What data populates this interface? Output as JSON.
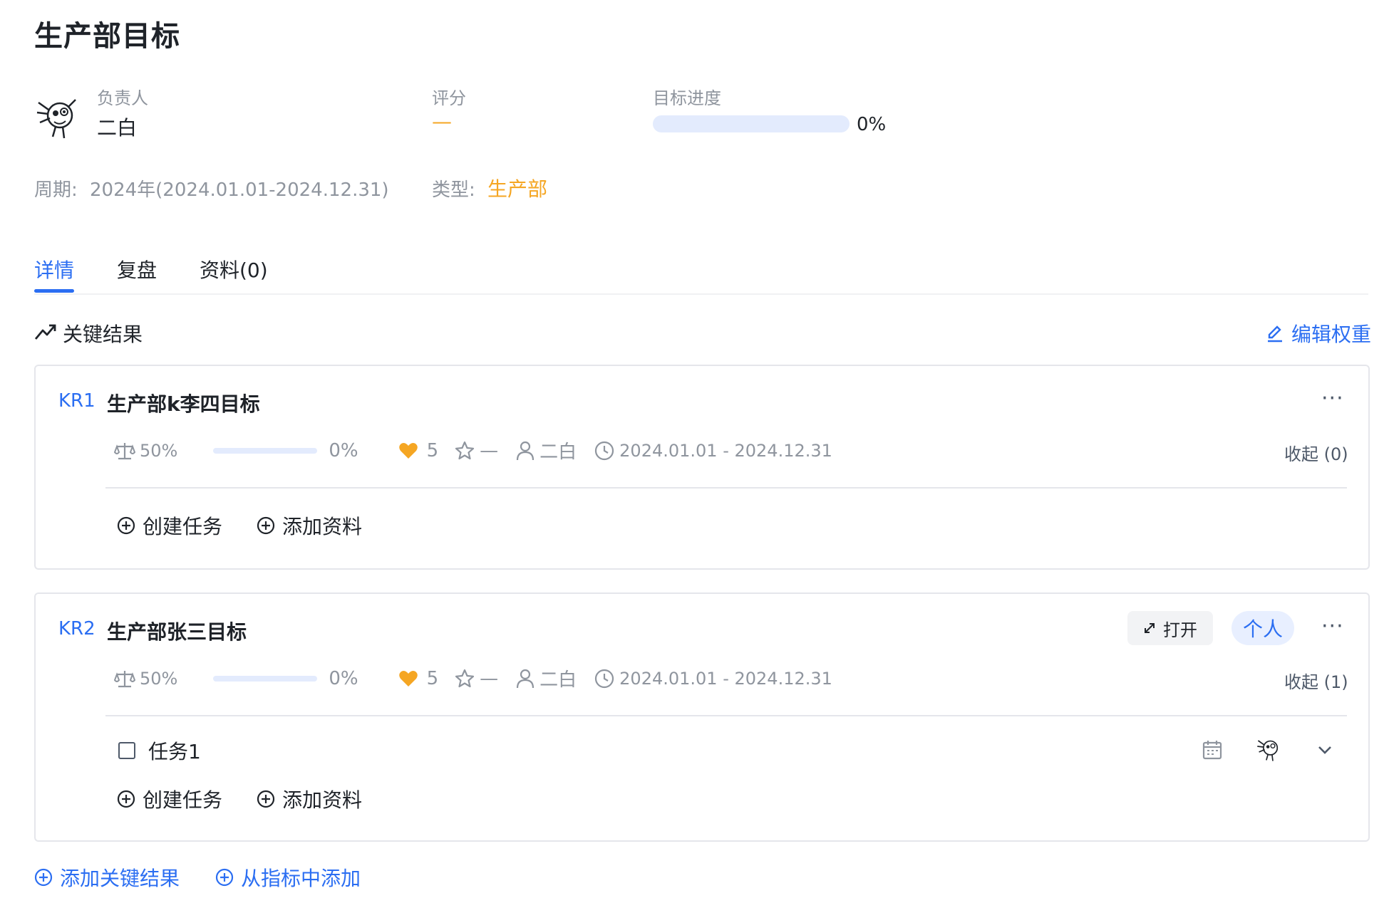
{
  "page": {
    "title": "生产部目标"
  },
  "owner": {
    "label": "负责人",
    "name": "二白"
  },
  "score": {
    "label": "评分",
    "value": "—"
  },
  "progress": {
    "label": "目标进度",
    "value_text": "0%",
    "value": 0
  },
  "period": {
    "label": "周期:",
    "value": "2024年(2024.01.01-2024.12.31)"
  },
  "type": {
    "label": "类型:",
    "value": "生产部"
  },
  "tabs": [
    {
      "label": "详情",
      "active": true
    },
    {
      "label": "复盘",
      "active": false
    },
    {
      "label": "资料(0)",
      "active": false
    }
  ],
  "key_results": {
    "section_title": "关键结果",
    "edit_weight_label": "编辑权重",
    "items": [
      {
        "code": "KR1",
        "title": "生产部k李四目标",
        "weight": "50%",
        "progress_text": "0%",
        "progress": 0,
        "confidence": "5",
        "rating": "—",
        "owner": "二白",
        "date_range": "2024.01.01 - 2024.12.31",
        "collapse_label": "收起 (0)",
        "actions": {
          "create_task": "创建任务",
          "add_material": "添加资料"
        }
      },
      {
        "code": "KR2",
        "title": "生产部张三目标",
        "open_label": "打开",
        "tag": "个人",
        "weight": "50%",
        "progress_text": "0%",
        "progress": 0,
        "confidence": "5",
        "rating": "—",
        "owner": "二白",
        "date_range": "2024.01.01 - 2024.12.31",
        "collapse_label": "收起 (1)",
        "tasks": [
          {
            "name": "任务1",
            "done": false
          }
        ],
        "actions": {
          "create_task": "创建任务",
          "add_material": "添加资料"
        }
      }
    ]
  },
  "footer": {
    "add_kr": "添加关键结果",
    "add_from_metric": "从指标中添加"
  },
  "colors": {
    "accent_blue": "#2b6ef2",
    "accent_orange": "#f5a623",
    "muted": "#8f959e"
  },
  "icons": [
    "avatar-illustration",
    "trend-up-icon",
    "edit-icon",
    "balance-icon",
    "heart-icon",
    "star-icon",
    "user-icon",
    "clock-icon",
    "plus-circle-icon",
    "expand-icon",
    "more-icon",
    "calendar-icon",
    "chevron-down-icon"
  ]
}
